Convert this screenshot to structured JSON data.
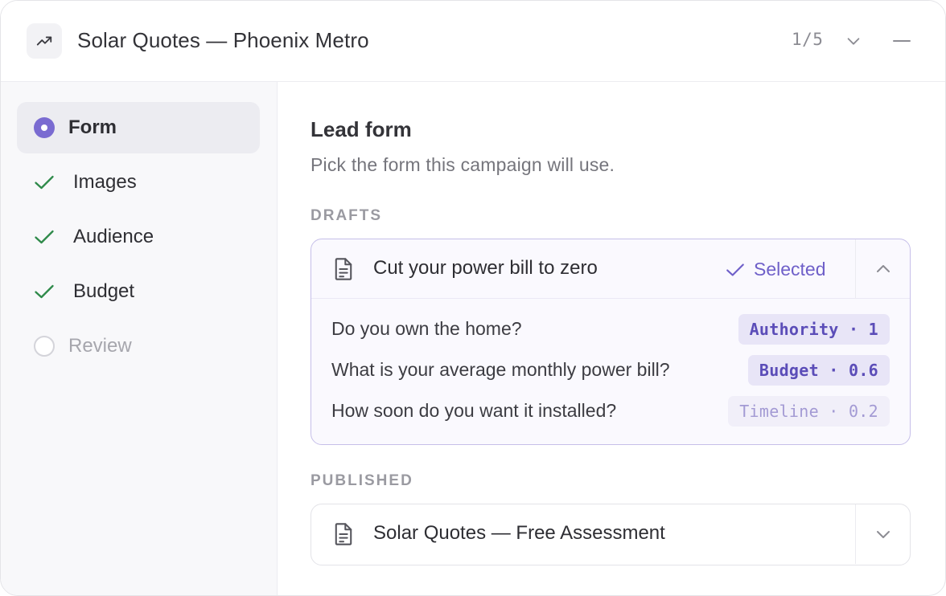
{
  "header": {
    "icon": "trending-up-icon",
    "title": "Solar Quotes — Phoenix Metro",
    "pager": "1/5"
  },
  "colors": {
    "accent": "#7a6bd1",
    "check": "#2f8a4a",
    "badge_text": "#5b4db8"
  },
  "steps": [
    {
      "label": "Form",
      "state": "active"
    },
    {
      "label": "Images",
      "state": "done"
    },
    {
      "label": "Audience",
      "state": "done"
    },
    {
      "label": "Budget",
      "state": "done"
    },
    {
      "label": "Review",
      "state": "pending"
    }
  ],
  "main": {
    "title": "Lead form",
    "subtitle": "Pick the form this campaign will use.",
    "drafts_label": "DRAFTS",
    "published_label": "PUBLISHED",
    "draft_card": {
      "name": "Cut your power bill to zero",
      "selected_label": "Selected",
      "questions": [
        {
          "text": "Do you own the home?",
          "badge": "Authority · 1"
        },
        {
          "text": "What is your average monthly power bill?",
          "badge": "Budget · 0.6"
        },
        {
          "text": "How soon do you want it installed?",
          "badge": "Timeline · 0.2"
        }
      ]
    },
    "published_card": {
      "name": "Solar Quotes — Free Assessment"
    }
  }
}
